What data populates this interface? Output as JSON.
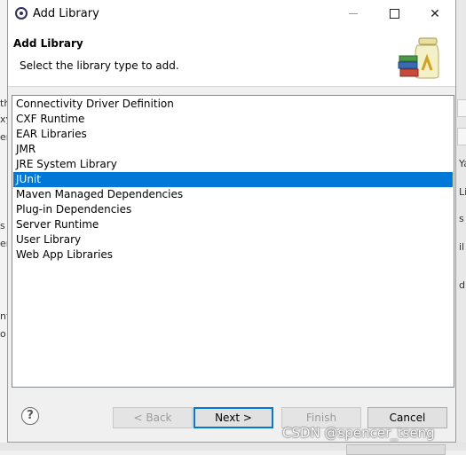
{
  "window": {
    "title": "Add Library"
  },
  "header": {
    "title": "Add Library",
    "description": "Select the library type to add."
  },
  "library_types": [
    {
      "label": "Connectivity Driver Definition",
      "selected": false
    },
    {
      "label": "CXF Runtime",
      "selected": false
    },
    {
      "label": "EAR Libraries",
      "selected": false
    },
    {
      "label": "JMR",
      "selected": false
    },
    {
      "label": "JRE System Library",
      "selected": false
    },
    {
      "label": "JUnit",
      "selected": true
    },
    {
      "label": "Maven Managed Dependencies",
      "selected": false
    },
    {
      "label": "Plug-in Dependencies",
      "selected": false
    },
    {
      "label": "Server Runtime",
      "selected": false
    },
    {
      "label": "User Library",
      "selected": false
    },
    {
      "label": "Web App Libraries",
      "selected": false
    }
  ],
  "buttons": {
    "help": "?",
    "back": "< Back",
    "next": "Next >",
    "finish": "Finish",
    "cancel": "Cancel"
  },
  "background_fragments": {
    "left": [
      "th",
      "xyl",
      "er",
      "s",
      "er",
      "nt",
      "o"
    ],
    "right": [
      "Ya",
      "Li",
      "s",
      "il",
      "d"
    ]
  },
  "watermark": "CSDN @spencer_tseng",
  "colors": {
    "selection": "#0078d7",
    "default_button_border": "#0078d7"
  }
}
